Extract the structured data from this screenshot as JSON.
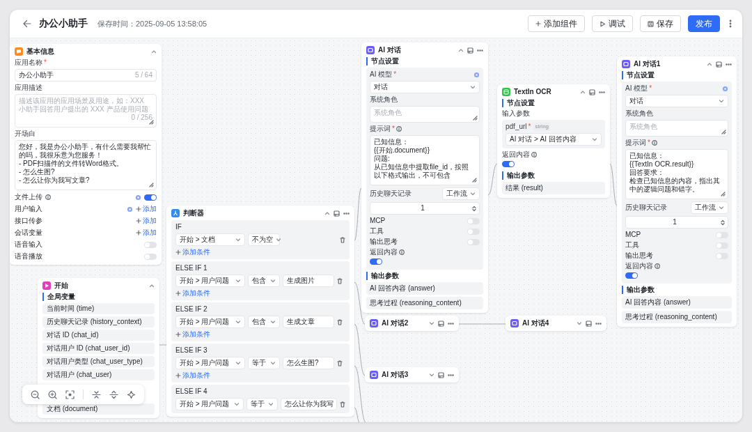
{
  "header": {
    "title": "办公小助手",
    "save_time": "保存时间：2025-09-05 13:58:05",
    "buttons": [
      {
        "label": "添加组件",
        "kind": "add"
      },
      {
        "label": "调试",
        "kind": "debug"
      },
      {
        "label": "保存",
        "kind": "save"
      },
      {
        "label": "发布",
        "kind": "primary"
      }
    ]
  },
  "basic_info": {
    "title": "基本信息",
    "name_label": "应用名称",
    "required_mark": "*",
    "name_value": "办公小助手",
    "name_count": "5 / 64",
    "desc_label": "应用描述",
    "desc_placeholder": "描述该应用的应用场景及用途，如：XXX 小助手回答用户提出的 XXX 产品使用问题",
    "desc_count": "0 / 256",
    "opening_label": "开场白",
    "opening_lines": [
      "您好，我是办公小助手，有什么需要我帮忙的吗，我很乐意为您服务！",
      "-  PDF扫描件的文件转Word格式。",
      "-  怎么生图?",
      "-  怎么让你为我写文章?"
    ],
    "settings": [
      {
        "label": "文件上传",
        "kind": "toggle",
        "info": true,
        "gear": true,
        "on": true
      },
      {
        "label": "用户输入",
        "kind": "add",
        "gear": true,
        "action": "添加"
      },
      {
        "label": "接口传参",
        "kind": "add",
        "action": "添加"
      },
      {
        "label": "会话变量",
        "kind": "add",
        "action": "添加"
      },
      {
        "label": "语音输入",
        "kind": "toggle",
        "on": false
      },
      {
        "label": "语音播放",
        "kind": "toggle",
        "on": false
      }
    ]
  },
  "start_node": {
    "title": "开始",
    "section": "全局变量",
    "variables": [
      "当前时间 (time)",
      "历史聊天记录 (history_context)",
      "对话 ID (chat_id)",
      "对话用户 ID (chat_user_id)",
      "对话用户类型 (chat_user_type)",
      "对话用户 (chat_user)"
    ],
    "more_variables": [
      "文档 (document)"
    ]
  },
  "judge_node": {
    "title": "判断器",
    "branches": [
      {
        "label": "IF",
        "conditions": [
          {
            "field": "开始 > 文档",
            "operator": "不为空"
          }
        ],
        "add": "添加条件"
      },
      {
        "label": "ELSE IF 1",
        "conditions": [
          {
            "field": "开始 > 用户问题",
            "operator": "包含",
            "value": "生成图片"
          }
        ],
        "add": "添加条件"
      },
      {
        "label": "ELSE IF 2",
        "conditions": [
          {
            "field": "开始 > 用户问题",
            "operator": "包含",
            "value": "生成文章"
          }
        ],
        "add": "添加条件"
      },
      {
        "label": "ELSE IF 3",
        "conditions": [
          {
            "field": "开始 > 用户问题",
            "operator": "等于",
            "value": "怎么生图?"
          }
        ],
        "add": "添加条件"
      },
      {
        "label": "ELSE IF 4",
        "conditions": [
          {
            "field": "开始 > 用户问题",
            "operator": "等于",
            "value": "怎么让你为我写"
          }
        ]
      }
    ]
  },
  "ai_node": {
    "title": "AI 对话",
    "section": "节点设置",
    "model_label": "AI 模型",
    "required_mark": "*",
    "model_value": "对话",
    "role_label": "系统角色",
    "role_placeholder": "系统角色",
    "prompt_label": "提示词",
    "prompt_required_mark": "*",
    "prompt_lines": [
      "已知信息：",
      "{{开始.document}}",
      "问题:",
      "从已知信息中提取file_id，按照以下格式输出，不可包含"
    ],
    "history_label": "历史聊天记录",
    "history_mode": "工作流",
    "history_count": "1",
    "switches": [
      {
        "label": "MCP",
        "on": false
      },
      {
        "label": "工具",
        "on": false
      },
      {
        "label": "输出思考",
        "on": false
      }
    ],
    "return_label": "返回内容",
    "return_on": true,
    "output_section": "输出参数",
    "outputs": [
      "AI 回答内容 (answer)",
      "思考过程 (reasoning_content)"
    ]
  },
  "ocr_node": {
    "title": "TextIn OCR",
    "section": "节点设置",
    "input_label": "输入参数",
    "param_name": "pdf_url",
    "required_mark": "*",
    "param_type": "string",
    "param_value": "AI 对话 > AI 回答内容",
    "return_label": "返回内容",
    "return_on": true,
    "output_section": "输出参数",
    "outputs": [
      "结果 (result)"
    ]
  },
  "ai_node_1": {
    "title": "AI 对话1",
    "section": "节点设置",
    "model_label": "AI 模型",
    "required_mark": "*",
    "model_value": "对话",
    "role_label": "系统角色",
    "role_placeholder": "系统角色",
    "prompt_label": "提示词",
    "prompt_required_mark": "*",
    "prompt_lines": [
      "已知信息：",
      "{{TextIn OCR.result}}",
      "回答要求：",
      "检查已知信息的内容，指出其中的逻辑问题和错字。"
    ],
    "history_label": "历史聊天记录",
    "history_mode": "工作流",
    "history_count": "1",
    "switches": [
      {
        "label": "MCP",
        "on": false
      },
      {
        "label": "工具",
        "on": false
      },
      {
        "label": "输出思考",
        "on": false
      }
    ],
    "return_label": "返回内容",
    "return_on": true,
    "output_section": "输出参数",
    "outputs": [
      "AI 回答内容 (answer)",
      "思考过程 (reasoning_content)"
    ]
  },
  "collapsed_nodes": [
    {
      "title": "AI 对话2"
    },
    {
      "title": "AI 对话3"
    },
    {
      "title": "AI 对话4"
    }
  ]
}
